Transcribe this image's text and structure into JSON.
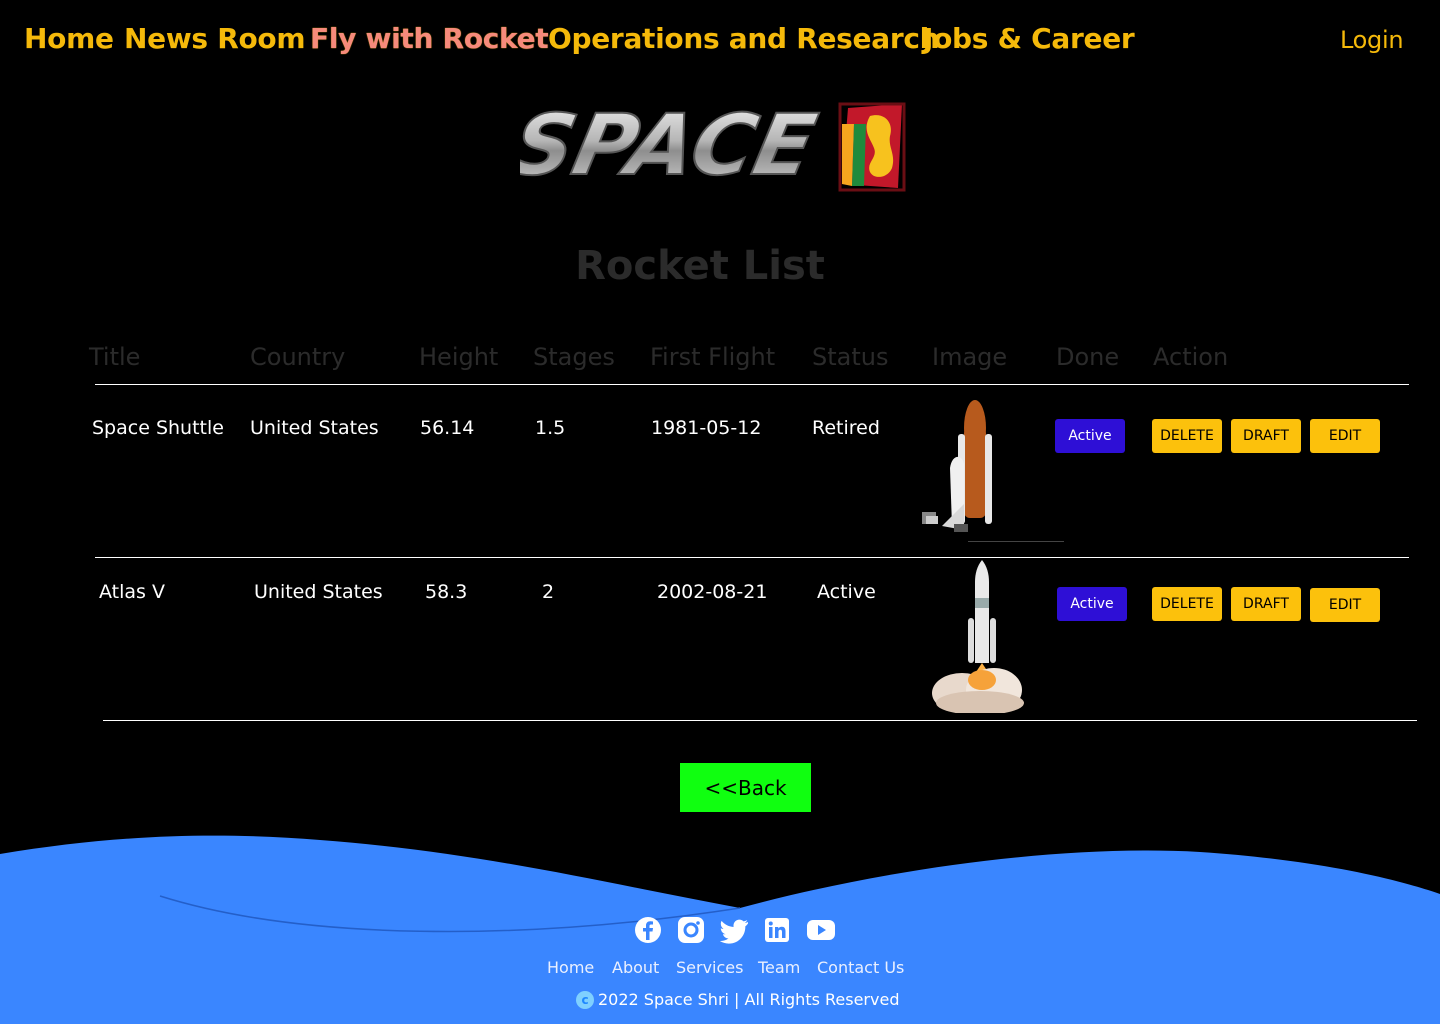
{
  "nav": {
    "home": "Home",
    "news": "News Room",
    "fly": "Fly with Rocket",
    "ops": "Operations and Research",
    "jobs": "Jobs & Career",
    "login": "Login"
  },
  "logo": {
    "text": "SPACE"
  },
  "page_title": "Rocket List",
  "table": {
    "headers": [
      "Title",
      "Country",
      "Height",
      "Stages",
      "First Flight",
      "Status",
      "Image",
      "Done",
      "Action"
    ],
    "rows": [
      {
        "title": "Space Shuttle",
        "country": "United States",
        "height": "56.14",
        "stages": "1.5",
        "first_flight": "1981-05-12",
        "status": "Retired",
        "done": "Active",
        "delete": "DELETE",
        "draft": "DRAFT",
        "edit": "EDIT"
      },
      {
        "title": "Atlas V",
        "country": "United States",
        "height": "58.3",
        "stages": "2",
        "first_flight": "2002-08-21",
        "status": "Active",
        "done": "Active",
        "delete": "DELETE",
        "draft": "DRAFT",
        "edit": "EDIT"
      }
    ]
  },
  "back_button": "<<Back",
  "footer": {
    "links": [
      "Home",
      "About",
      "Services",
      "Team",
      "Contact Us"
    ],
    "copyright": "2022 Space Shri | All Rights Reserved",
    "copyright_symbol": "c",
    "socials": [
      "facebook-icon",
      "instagram-icon",
      "twitter-icon",
      "linkedin-icon",
      "youtube-icon"
    ]
  },
  "colors": {
    "nav": "#f5b90a",
    "nav_active": "#f68a7b",
    "done_button": "#2e0fd6",
    "action_button": "#fcc10c",
    "back_button": "#10ff10",
    "footer": "#3a86ff"
  }
}
